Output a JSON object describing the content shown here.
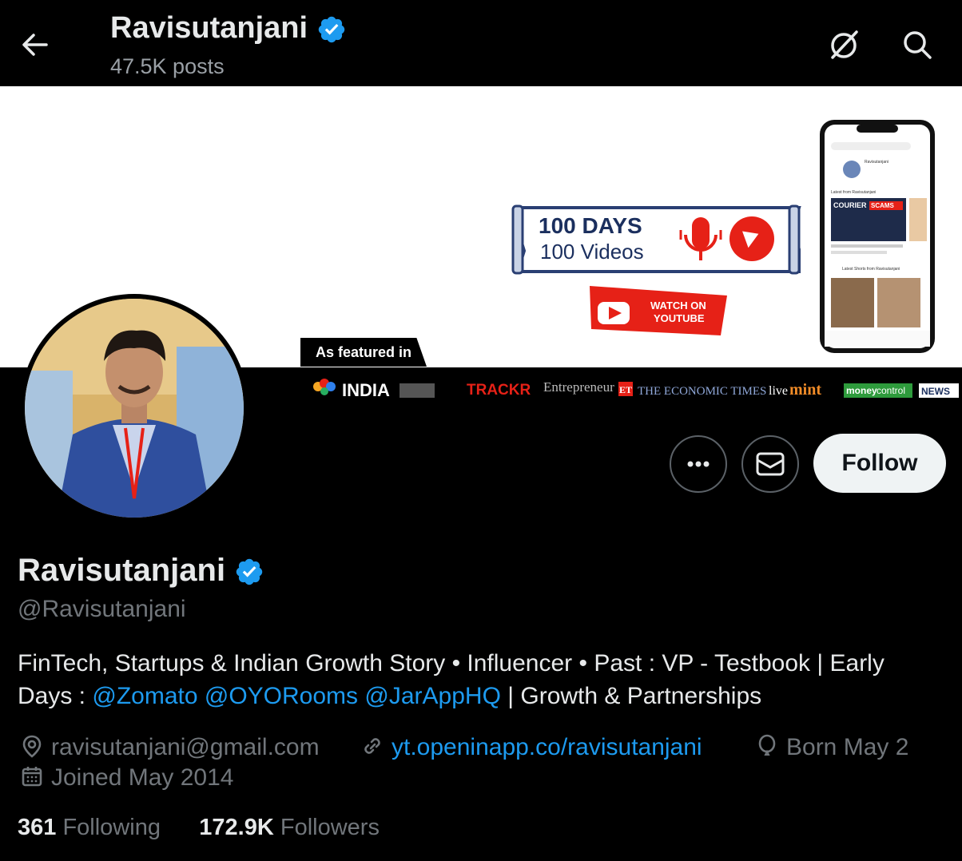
{
  "header": {
    "title": "Ravisutanjani",
    "posts": "47.5K posts"
  },
  "banner": {
    "days_line1": "100 DAYS",
    "days_line2": "100 Videos",
    "watch_line1": "WATCH ON",
    "watch_line2": "YOUTUBE",
    "featured_label": "As featured in",
    "media_logos": [
      "INDIA",
      "TRACKR",
      "Entrepreneur",
      "ET",
      "THE ECONOMIC TIMES",
      "live",
      "mint",
      "money",
      "control",
      "NEWS"
    ],
    "phone": {
      "channel": "Ravisutanjani",
      "latest_from": "Latest from Ravisutanjani",
      "thumb_line1": "COURIER",
      "thumb_line2": "SCAMS",
      "latest_shorts": "Latest Shorts from Ravisutanjani"
    }
  },
  "profile": {
    "name": "Ravisutanjani",
    "handle": "@Ravisutanjani",
    "bio_text1": "FinTech, Startups & Indian Growth Story • Influencer • Past : VP - Testbook | Early Days : ",
    "mention1": "@Zomato",
    "mention2": "@OYORooms",
    "mention3": "@JarAppHQ",
    "bio_text2": " | Growth & Partnerships",
    "email": "ravisutanjani@gmail.com",
    "website": "yt.openinapp.co/ravisutanjani",
    "birthday": "Born May 2",
    "joined": "Joined May 2014",
    "following_count": "361",
    "following_label": "Following",
    "followers_count": "172.9K",
    "followers_label": "Followers",
    "follow_label": "Follow"
  },
  "colors": {
    "accent": "#1d9bf0",
    "youtube_red": "#e62117",
    "banner_navy": "#1b2f5e"
  }
}
